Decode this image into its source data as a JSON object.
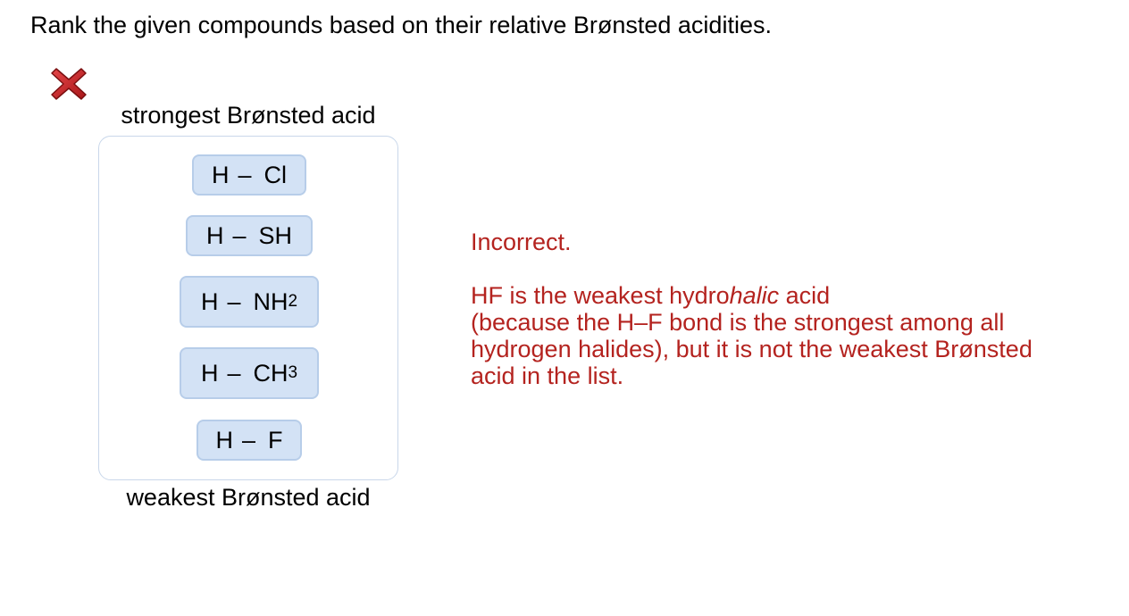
{
  "question": {
    "text": "Rank the given compounds based on their relative Brønsted acidities."
  },
  "status": {
    "icon": "red-x-icon",
    "color": "#c0282a"
  },
  "ranking": {
    "top_label": "strongest Brønsted acid",
    "bottom_label": "weakest Brønsted acid",
    "items": [
      {
        "h": "H",
        "dash": "–",
        "group": "Cl",
        "sub": ""
      },
      {
        "h": "H",
        "dash": "–",
        "group": "SH",
        "sub": ""
      },
      {
        "h": "H",
        "dash": "–",
        "group": "NH",
        "sub": "2"
      },
      {
        "h": "H",
        "dash": "–",
        "group": "CH",
        "sub": "3"
      },
      {
        "h": "H",
        "dash": "–",
        "group": "F",
        "sub": ""
      }
    ]
  },
  "feedback": {
    "title": "Incorrect.",
    "line1_pre": "HF is the weakest hydro",
    "line1_italic": "halic",
    "line1_post": " acid",
    "rest": "(because the H–F bond is the strongest among all hydrogen halides), but it is not the weakest Brønsted acid in the list.",
    "color": "#b4231f"
  }
}
